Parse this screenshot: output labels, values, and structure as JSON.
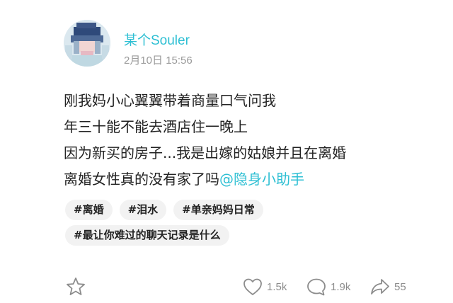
{
  "post": {
    "author": "某个Souler",
    "time": "2月10日 15:56",
    "lines": [
      "刚我妈小心翼翼带着商量口气问我",
      "年三十能不能去酒店住一晚上",
      "因为新买的房子...我是出嫁的姑娘并且在离婚",
      "离婚女性真的没有家了吗"
    ],
    "mention": "@隐身小助手",
    "tags": [
      "#离婚",
      "#泪水",
      "#单亲妈妈日常",
      "#最让你难过的聊天记录是什么"
    ]
  },
  "actions": {
    "likes": "1.5k",
    "comments": "1.9k",
    "shares": "55"
  },
  "colors": {
    "accent": "#2dbfd3",
    "text": "#222222",
    "muted": "#9a9a9a",
    "tag_bg": "#f2f2f2"
  },
  "icons": {
    "favorite": "star-outline-icon",
    "like": "heart-outline-icon",
    "comment": "speech-bubble-icon",
    "share": "share-arrow-icon"
  }
}
